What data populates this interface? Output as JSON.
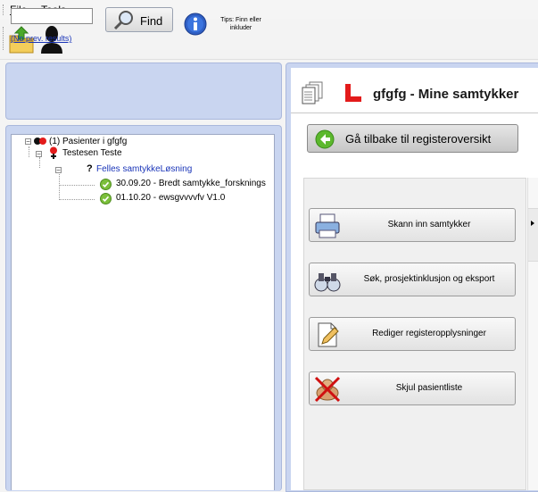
{
  "menu": {
    "file": {
      "underlined": "F",
      "rest": "ile"
    },
    "tools": {
      "underlined": "T",
      "rest": "ools"
    }
  },
  "search": {
    "value": "",
    "placeholder": "",
    "prev_results": "(No prev. results)",
    "find_label": "Find",
    "tips": "Tips: Finn eller inkluder"
  },
  "tree": {
    "root": "(1) Pasienter i gfgfg",
    "patient": "Testesen Teste",
    "group_mark": "?",
    "group": "Felles samtykkeLøsning",
    "items": [
      "30.09.20 - Bredt samtykke_forsknings",
      "01.10.20 - ewsgvvvvfv V1.0"
    ]
  },
  "header": {
    "title": "gfgfg - Mine samtykker"
  },
  "back_button": "Gå tilbake til registeroversikt",
  "actions": [
    {
      "label": "Skann inn samtykker",
      "icon": "printer-icon"
    },
    {
      "label": "Søk, prosjektinklusjon og eksport",
      "icon": "binoculars-icon"
    },
    {
      "label": "Rediger registeropplysninger",
      "icon": "edit-document-icon"
    },
    {
      "label": "Skjul pasientliste",
      "icon": "hide-patient-list-icon"
    }
  ],
  "colors": {
    "panel_bg": "#c9d5f0",
    "link": "#1a35b8",
    "tree_group": "#1a35b8",
    "accent_red": "#e31b1b",
    "check_green": "#7bbf3a",
    "back_green": "#5cb82d"
  }
}
